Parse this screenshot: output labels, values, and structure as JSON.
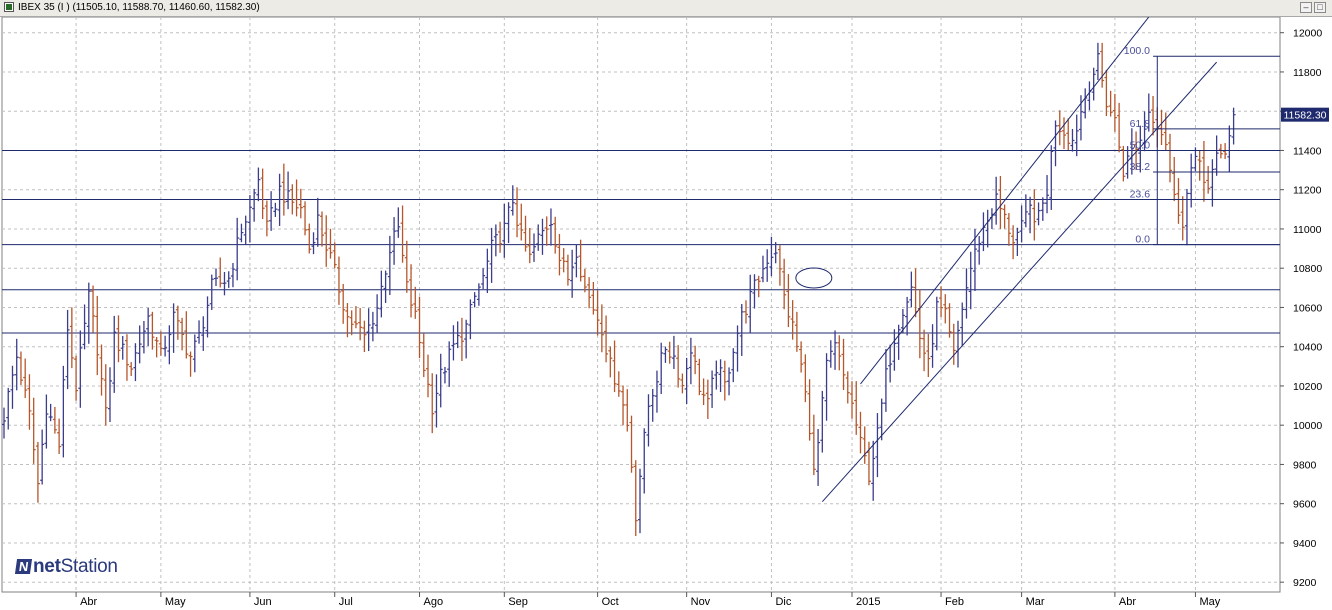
{
  "window": {
    "title": "IBEX 35 (I ) (11505.10, 11588.70, 11460.60, 11582.30)"
  },
  "logo": {
    "bold": "net",
    "rest": "Station"
  },
  "chart_data": {
    "type": "ohlc",
    "ylim": [
      9150,
      12080
    ],
    "y_ticks": [
      9200,
      9400,
      9600,
      9800,
      10000,
      10200,
      10400,
      10600,
      10800,
      11000,
      11200,
      11400,
      11600,
      11800,
      12000
    ],
    "x_ticks": [
      {
        "i": 17,
        "label": "Abr"
      },
      {
        "i": 37,
        "label": "May"
      },
      {
        "i": 58,
        "label": "Jun"
      },
      {
        "i": 78,
        "label": "Jul"
      },
      {
        "i": 98,
        "label": "Ago"
      },
      {
        "i": 118,
        "label": "Sep"
      },
      {
        "i": 140,
        "label": "Oct"
      },
      {
        "i": 161,
        "label": "Nov"
      },
      {
        "i": 181,
        "label": "Dic"
      },
      {
        "i": 200,
        "label": "2015"
      },
      {
        "i": 221,
        "label": "Feb"
      },
      {
        "i": 240,
        "label": "Mar"
      },
      {
        "i": 262,
        "label": "Abr"
      },
      {
        "i": 281,
        "label": "May"
      }
    ],
    "last_price": "11582.30",
    "anchors": [
      [
        0,
        10050
      ],
      [
        3,
        10350
      ],
      [
        6,
        10050
      ],
      [
        8,
        9700
      ],
      [
        10,
        10100
      ],
      [
        13,
        9900
      ],
      [
        15,
        10500
      ],
      [
        17,
        10200
      ],
      [
        20,
        10650
      ],
      [
        22,
        10400
      ],
      [
        24,
        10050
      ],
      [
        26,
        10450
      ],
      [
        30,
        10300
      ],
      [
        34,
        10550
      ],
      [
        37,
        10350
      ],
      [
        40,
        10550
      ],
      [
        44,
        10350
      ],
      [
        46,
        10450
      ],
      [
        49,
        10700
      ],
      [
        53,
        10750
      ],
      [
        56,
        11000
      ],
      [
        58,
        11100
      ],
      [
        60,
        11250
      ],
      [
        62,
        11000
      ],
      [
        65,
        11200
      ],
      [
        67,
        11150
      ],
      [
        70,
        11100
      ],
      [
        72,
        10900
      ],
      [
        74,
        11050
      ],
      [
        77,
        10850
      ],
      [
        79,
        10700
      ],
      [
        81,
        10550
      ],
      [
        83,
        10500
      ],
      [
        85,
        10450
      ],
      [
        88,
        10600
      ],
      [
        91,
        10900
      ],
      [
        93,
        11000
      ],
      [
        95,
        10700
      ],
      [
        97,
        10550
      ],
      [
        99,
        10300
      ],
      [
        101,
        10100
      ],
      [
        103,
        10250
      ],
      [
        106,
        10400
      ],
      [
        109,
        10500
      ],
      [
        111,
        10650
      ],
      [
        113,
        10750
      ],
      [
        115,
        10900
      ],
      [
        118,
        11000
      ],
      [
        120,
        11150
      ],
      [
        122,
        10950
      ],
      [
        124,
        10850
      ],
      [
        126,
        10950
      ],
      [
        129,
        11050
      ],
      [
        131,
        10850
      ],
      [
        133,
        10750
      ],
      [
        135,
        10900
      ],
      [
        137,
        10700
      ],
      [
        139,
        10600
      ],
      [
        141,
        10500
      ],
      [
        143,
        10300
      ],
      [
        145,
        10200
      ],
      [
        147,
        10000
      ],
      [
        148,
        9800
      ],
      [
        149,
        9550
      ],
      [
        150,
        9750
      ],
      [
        152,
        10100
      ],
      [
        154,
        10250
      ],
      [
        156,
        10400
      ],
      [
        158,
        10350
      ],
      [
        160,
        10200
      ],
      [
        162,
        10400
      ],
      [
        164,
        10200
      ],
      [
        166,
        10100
      ],
      [
        168,
        10300
      ],
      [
        170,
        10200
      ],
      [
        172,
        10400
      ],
      [
        174,
        10550
      ],
      [
        176,
        10650
      ],
      [
        178,
        10750
      ],
      [
        180,
        10850
      ],
      [
        182,
        10900
      ],
      [
        184,
        10650
      ],
      [
        186,
        10500
      ],
      [
        188,
        10300
      ],
      [
        190,
        10000
      ],
      [
        191,
        9750
      ],
      [
        192,
        9900
      ],
      [
        194,
        10300
      ],
      [
        196,
        10400
      ],
      [
        198,
        10250
      ],
      [
        200,
        10100
      ],
      [
        202,
        9900
      ],
      [
        204,
        9750
      ],
      [
        206,
        9950
      ],
      [
        208,
        10250
      ],
      [
        210,
        10450
      ],
      [
        212,
        10600
      ],
      [
        214,
        10700
      ],
      [
        216,
        10450
      ],
      [
        218,
        10300
      ],
      [
        220,
        10600
      ],
      [
        222,
        10550
      ],
      [
        224,
        10350
      ],
      [
        226,
        10600
      ],
      [
        228,
        10800
      ],
      [
        230,
        10950
      ],
      [
        232,
        11050
      ],
      [
        234,
        11150
      ],
      [
        236,
        11050
      ],
      [
        238,
        10950
      ],
      [
        240,
        11000
      ],
      [
        242,
        11100
      ],
      [
        244,
        11050
      ],
      [
        246,
        11200
      ],
      [
        248,
        11550
      ],
      [
        250,
        11500
      ],
      [
        252,
        11450
      ],
      [
        254,
        11600
      ],
      [
        256,
        11750
      ],
      [
        258,
        11850
      ],
      [
        260,
        11650
      ],
      [
        262,
        11550
      ],
      [
        264,
        11300
      ],
      [
        266,
        11400
      ],
      [
        268,
        11450
      ],
      [
        270,
        11600
      ],
      [
        272,
        11550
      ],
      [
        274,
        11450
      ],
      [
        276,
        11150
      ],
      [
        278,
        11050
      ],
      [
        280,
        11300
      ],
      [
        282,
        11350
      ],
      [
        284,
        11200
      ],
      [
        286,
        11350
      ],
      [
        288,
        11400
      ],
      [
        290,
        11582
      ]
    ],
    "horizontal_lines": [
      11400,
      11150,
      10920,
      10690,
      10470
    ],
    "fibonacci": {
      "high": 11880,
      "low": 10920,
      "levels": [
        {
          "label": "100.0",
          "value": 11880
        },
        {
          "label": "61.8",
          "value": 11510
        },
        {
          "label": "50.0",
          "value": 11400
        },
        {
          "label": "38.2",
          "value": 11290
        },
        {
          "label": "23.6",
          "value": 11150
        },
        {
          "label": "0.0",
          "value": 10920
        }
      ]
    },
    "colors": {
      "up": "#3a3c8c",
      "down": "#b5562a",
      "lines": "#1f2a6e",
      "grid": "#c0c0c0",
      "background": "#ffffff",
      "price_tag_bg": "#1f2a6e",
      "price_tag_text": "#ffffff"
    }
  }
}
